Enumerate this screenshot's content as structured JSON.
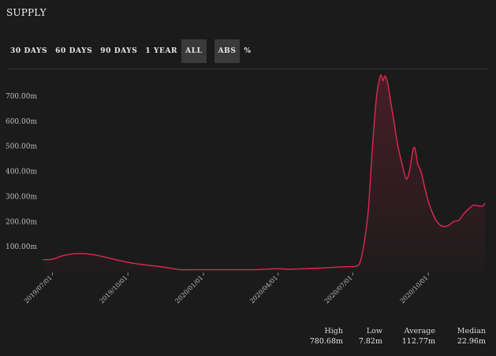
{
  "header": {
    "title": "SUPPLY"
  },
  "range_buttons": [
    {
      "label": "30 DAYS",
      "active": false
    },
    {
      "label": "60 DAYS",
      "active": false
    },
    {
      "label": "90 DAYS",
      "active": false
    },
    {
      "label": "1 YEAR",
      "active": false
    },
    {
      "label": "ALL",
      "active": true
    }
  ],
  "mode_buttons": [
    {
      "label": "ABS",
      "active": true
    },
    {
      "label": "%",
      "active": false
    }
  ],
  "stats": {
    "high": {
      "label": "High",
      "value": "780.68m"
    },
    "low": {
      "label": "Low",
      "value": "7.82m"
    },
    "average": {
      "label": "Average",
      "value": "112.77m"
    },
    "median": {
      "label": "Median",
      "value": "22.96m"
    }
  },
  "colors": {
    "line": "#e0284f",
    "background": "#1b1b1b",
    "active_button": "#3a3a3a"
  },
  "chart_data": {
    "type": "area",
    "title": "",
    "xlabel": "",
    "ylabel": "",
    "ylim": [
      0,
      800
    ],
    "y_ticks": [
      100,
      200,
      300,
      400,
      500,
      600,
      700
    ],
    "y_tick_labels": [
      "100.00m",
      "200.00m",
      "300.00m",
      "400.00m",
      "500.00m",
      "600.00m",
      "700.00m"
    ],
    "x_tick_labels": [
      "2019/07/01",
      "2019/10/01",
      "2020/01/01",
      "2020/04/01",
      "2020/07/01",
      "2020/10/01"
    ],
    "x_range": [
      "2019-06-20",
      "2020-12-09"
    ],
    "grid": false,
    "series": [
      {
        "x": [
          "2019-06-20",
          "2019-07-01",
          "2019-07-15",
          "2019-07-30",
          "2019-08-15",
          "2019-09-01",
          "2019-09-20",
          "2019-10-05",
          "2019-10-20",
          "2019-11-05",
          "2019-11-20",
          "2019-12-05",
          "2019-12-20",
          "2020-01-05",
          "2020-02-01",
          "2020-03-01",
          "2020-03-15",
          "2020-04-01",
          "2020-04-15",
          "2020-05-01",
          "2020-05-20",
          "2020-06-10",
          "2020-06-25",
          "2020-07-05",
          "2020-07-10",
          "2020-07-15",
          "2020-07-20",
          "2020-07-25",
          "2020-07-30",
          "2020-08-03",
          "2020-08-05",
          "2020-08-07",
          "2020-08-09",
          "2020-08-12",
          "2020-08-15",
          "2020-08-20",
          "2020-08-25",
          "2020-08-30",
          "2020-09-04",
          "2020-09-08",
          "2020-09-12",
          "2020-09-14",
          "2020-09-16",
          "2020-09-18",
          "2020-09-22",
          "2020-09-27",
          "2020-10-02",
          "2020-10-08",
          "2020-10-14",
          "2020-10-20",
          "2020-10-26",
          "2020-11-01",
          "2020-11-07",
          "2020-11-13",
          "2020-11-19",
          "2020-11-25",
          "2020-12-01",
          "2020-12-06",
          "2020-12-09"
        ],
        "y": [
          48,
          50,
          65,
          72,
          70,
          60,
          45,
          35,
          28,
          22,
          15,
          8,
          8,
          8,
          8,
          8,
          10,
          12,
          10,
          12,
          14,
          18,
          20,
          22,
          40,
          120,
          250,
          500,
          700,
          775,
          780,
          760,
          780,
          760,
          700,
          600,
          500,
          430,
          370,
          400,
          480,
          495,
          470,
          430,
          400,
          330,
          270,
          220,
          190,
          180,
          185,
          200,
          205,
          230,
          250,
          265,
          262,
          262,
          272
        ]
      }
    ]
  }
}
